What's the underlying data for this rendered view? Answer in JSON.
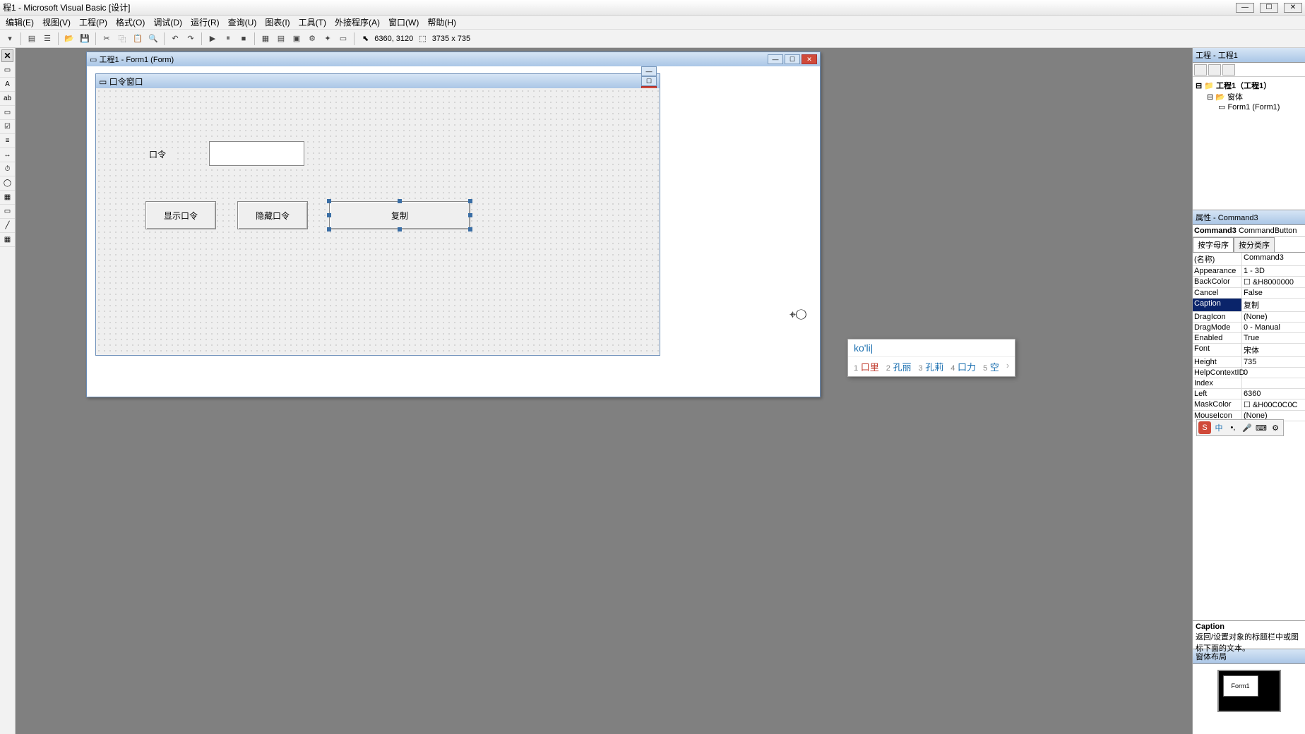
{
  "title": "程1 - Microsoft Visual Basic [设计]",
  "menu": [
    "编辑(E)",
    "视图(V)",
    "工程(P)",
    "格式(O)",
    "调试(D)",
    "运行(R)",
    "查询(U)",
    "图表(I)",
    "工具(T)",
    "外接程序(A)",
    "窗口(W)",
    "帮助(H)"
  ],
  "coord1": "6360, 3120",
  "coord2": "3735 x 735",
  "designer_title": "工程1 - Form1 (Form)",
  "form_caption": "口令窗口",
  "label1": "口令",
  "button1": "显示口令",
  "button2": "隐藏口令",
  "button3": "复制",
  "project": {
    "header": "工程 - 工程1",
    "root": "工程1（工程1）",
    "folder": "窗体",
    "form": "Form1 (Form1)"
  },
  "props": {
    "header": "属性 - Command3",
    "objname": "Command3",
    "objtype": "CommandButton",
    "tab_alpha": "按字母序",
    "tab_cat": "按分类序",
    "rows": [
      {
        "n": "(名称)",
        "v": "Command3"
      },
      {
        "n": "Appearance",
        "v": "1 - 3D"
      },
      {
        "n": "BackColor",
        "v": "☐ &H8000000"
      },
      {
        "n": "Cancel",
        "v": "False"
      },
      {
        "n": "Caption",
        "v": "复制",
        "sel": true
      },
      {
        "n": "DragIcon",
        "v": "(None)"
      },
      {
        "n": "DragMode",
        "v": "0 - Manual"
      },
      {
        "n": "Enabled",
        "v": "True"
      },
      {
        "n": "Font",
        "v": "宋体"
      },
      {
        "n": "Height",
        "v": "735"
      },
      {
        "n": "HelpContextID",
        "v": "0"
      },
      {
        "n": "Index",
        "v": ""
      },
      {
        "n": "Left",
        "v": "6360"
      },
      {
        "n": "MaskColor",
        "v": "☐ &H00C0C0C"
      },
      {
        "n": "MouseIcon",
        "v": "(None)"
      }
    ],
    "desc_name": "Caption",
    "desc_text": "返回/设置对象的标题栏中或图标下面的文本。"
  },
  "layout_header": "窗体布局",
  "layout_form": "Form1",
  "ime": {
    "input": "ko'li|",
    "cands": [
      {
        "n": "1",
        "t": "口里"
      },
      {
        "n": "2",
        "t": "孔丽"
      },
      {
        "n": "3",
        "t": "孔莉"
      },
      {
        "n": "4",
        "t": "口力"
      },
      {
        "n": "5",
        "t": "空"
      }
    ],
    "tool_cn": "中"
  }
}
